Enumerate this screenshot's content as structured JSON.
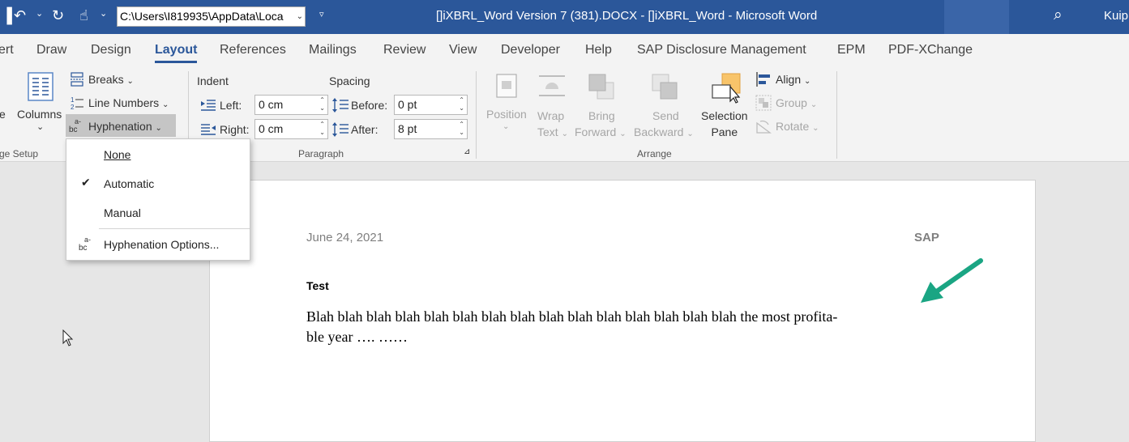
{
  "titlebar": {
    "path": "C:\\Users\\I819935\\AppData\\Loca",
    "title": "[]iXBRL_Word Version 7 (381).DOCX  -  []iXBRL_Word - Microsoft Word",
    "user": "Kuip"
  },
  "tabs": [
    "ert",
    "Draw",
    "Design",
    "Layout",
    "References",
    "Mailings",
    "Review",
    "View",
    "Developer",
    "Help",
    "SAP Disclosure Management",
    "EPM",
    "PDF-XChange"
  ],
  "active_tab": "Layout",
  "ribbon": {
    "page_setup": {
      "partial_button": "e",
      "columns": "Columns",
      "breaks": "Breaks",
      "line_numbers": "Line Numbers",
      "hyphenation": "Hyphenation",
      "group_label": "ge Setup"
    },
    "paragraph": {
      "indent_label": "Indent",
      "spacing_label": "Spacing",
      "left_label": "Left:",
      "right_label": "Right:",
      "before_label": "Before:",
      "after_label": "After:",
      "left_value": "0 cm",
      "right_value": "0 cm",
      "before_value": "0 pt",
      "after_value": "8 pt",
      "group_label": "Paragraph"
    },
    "arrange": {
      "position": "Position",
      "wrap_text_1": "Wrap",
      "wrap_text_2": "Text",
      "bring_forward_1": "Bring",
      "bring_forward_2": "Forward",
      "send_backward_1": "Send",
      "send_backward_2": "Backward",
      "selection_pane_1": "Selection",
      "selection_pane_2": "Pane",
      "align": "Align",
      "group": "Group",
      "rotate": "Rotate",
      "group_label": "Arrange"
    }
  },
  "hyphenation_menu": {
    "items": [
      "None",
      "Automatic",
      "Manual",
      "Hyphenation Options..."
    ],
    "checked": "Automatic"
  },
  "document": {
    "header_date": "June 24, 2021",
    "header_company": "SAP",
    "heading": "Test",
    "line1": "Blah blah blah blah blah blah blah blah blah blah blah blah blah blah blah the most profita-",
    "line2": "ble year …. ……"
  },
  "colors": {
    "titlebar": "#2b579a",
    "accent": "#2b579a",
    "annotation_arrow": "#1aa583"
  }
}
